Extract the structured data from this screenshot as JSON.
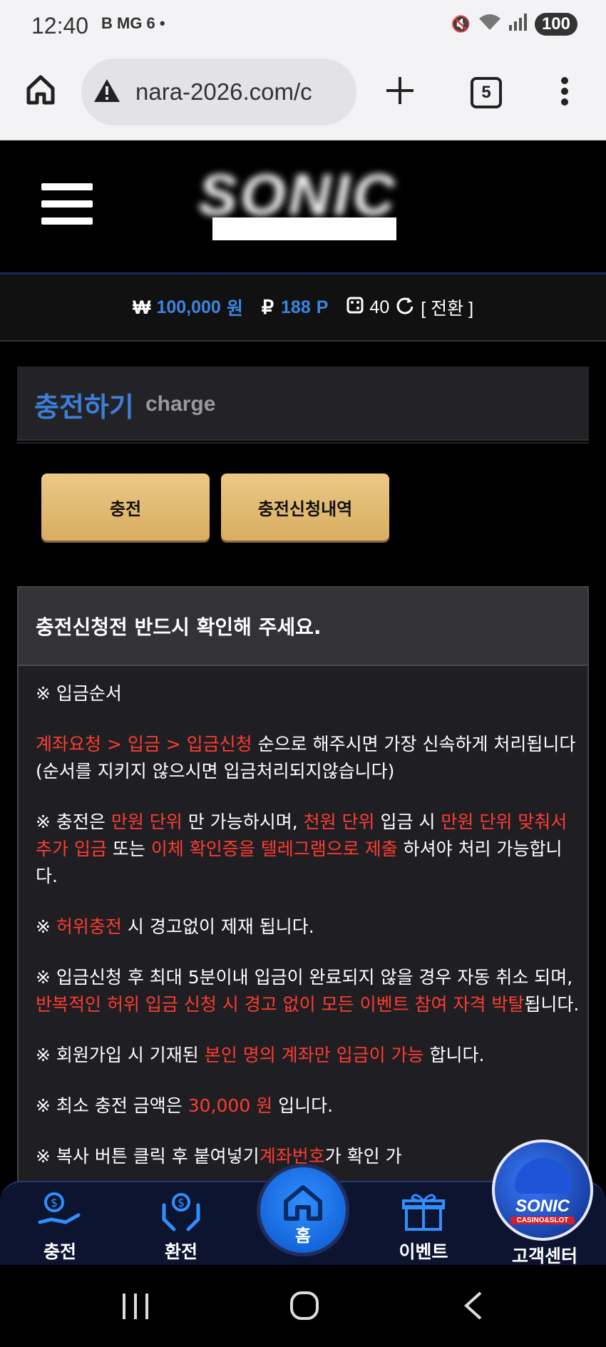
{
  "status_bar": {
    "time": "12:40",
    "notif_text": "B MG 6 •",
    "battery": "100"
  },
  "browser": {
    "url": "nara-2026.com/c",
    "tab_count": "5"
  },
  "site": {
    "logo_text": "SONIC"
  },
  "balance": {
    "won_symbol": "₩",
    "won_amount": "100,000",
    "won_unit": "원",
    "point_symbol": "₽",
    "point_amount": "188",
    "point_unit": "P",
    "chip_count": "40",
    "switch_label": "[ 전환 ]"
  },
  "page_title": {
    "korean": "충전하기",
    "english": "charge"
  },
  "tabs": [
    {
      "label": "충전"
    },
    {
      "label": "충전신청내역"
    }
  ],
  "notice": {
    "heading": "충전신청전 반드시 확인해 주세요.",
    "p1": "※ 입금순서",
    "p2_red": "계좌요청 > 입금 > 입금신청",
    "p2_rest": " 순으로 해주시면 가장 신속하게 처리됩니다 (순서를 지키지 않으시면 입금처리되지않습니다)",
    "p3_a": "※ 충전은 ",
    "p3_red1": "만원 단위",
    "p3_b": " 만 가능하시며, ",
    "p3_red2": "천원 단위",
    "p3_c": " 입금 시 ",
    "p3_red3": "만원 단위 맞춰서 추가 입금",
    "p3_d": " 또는 ",
    "p3_red4": "이체 확인증을 텔레그램으로 제출",
    "p3_e": " 하셔야 처리 가능합니다.",
    "p4_a": "※ ",
    "p4_red": "허위충전",
    "p4_b": " 시 경고없이 제재 됩니다.",
    "p5_a": "※ 입금신청 후 최대 5분이내 입금이 완료되지 않을 경우 자동 취소 되며, ",
    "p5_red": "반복적인 허위 입금 신청 시 경고 없이 모든 이벤트 참여 자격 박탈",
    "p5_b": "됩니다.",
    "p6_a": "※ 회원가입 시 기재된 ",
    "p6_red": "본인 명의 계좌만 입금이 가능",
    "p6_b": " 합니다.",
    "p7_a": "※ 최소 충전 금액은 ",
    "p7_red": "30,000 원",
    "p7_b": " 입니다.",
    "p8_a": "※ 복사 버튼 클릭 후 붙여넣기",
    "p8_red": "계좌번호",
    "p8_b": "가 확인 가"
  },
  "bottom_nav": [
    {
      "label": "충전"
    },
    {
      "label": "환전"
    },
    {
      "label": "홈"
    },
    {
      "label": "이벤트"
    },
    {
      "label": "고객센터"
    }
  ],
  "avatar": {
    "line1": "SONIC",
    "line2": "CASINO&SLOT"
  },
  "colors": {
    "accent_blue": "#3a86e0",
    "warning_red": "#ff3b2f",
    "gold": "#e3bb73"
  }
}
